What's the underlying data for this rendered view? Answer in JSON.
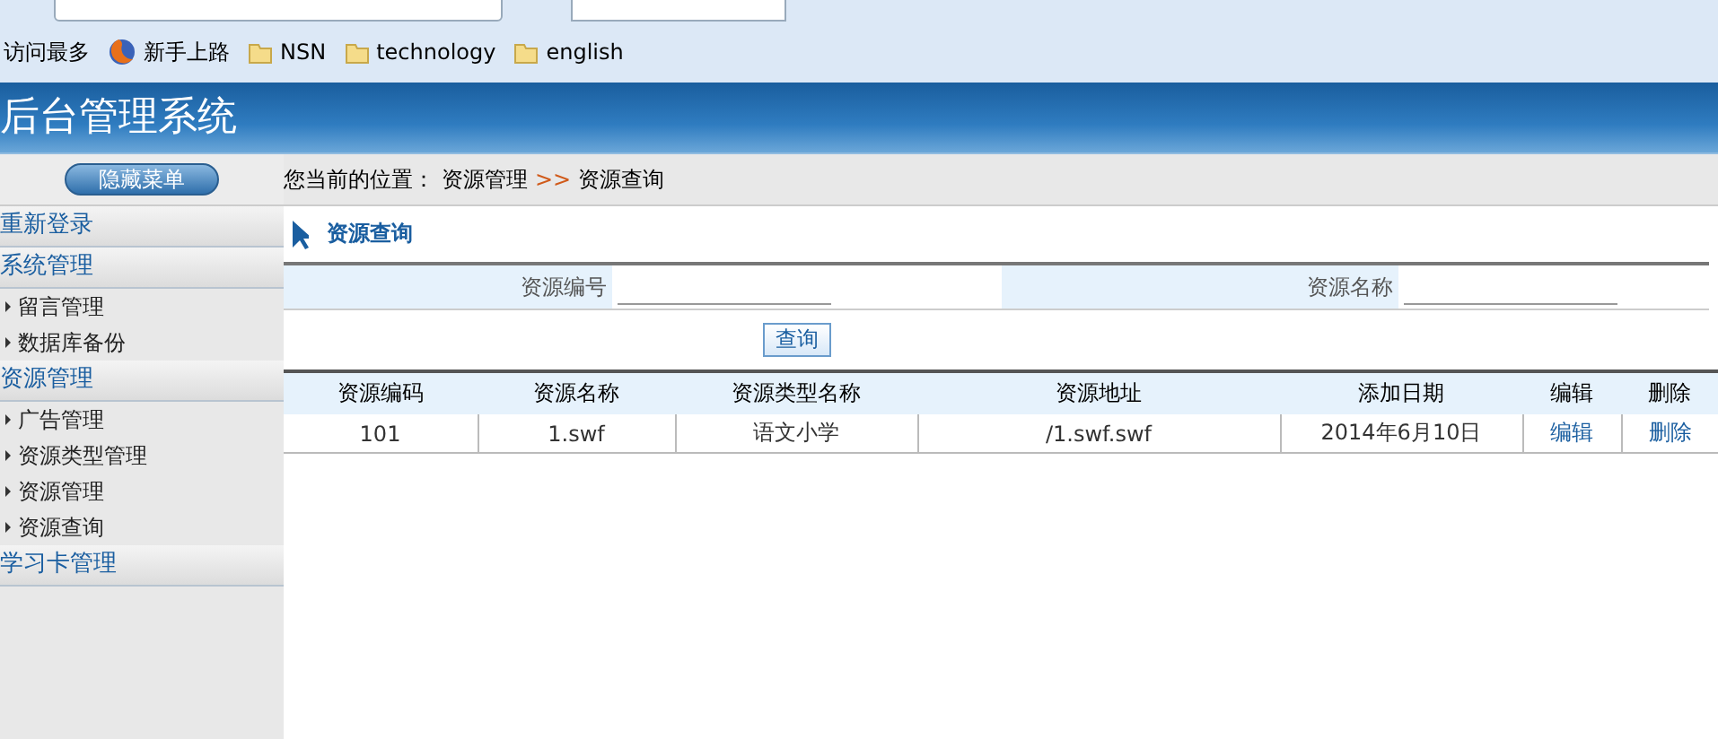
{
  "browser": {
    "bookmarks": [
      {
        "label": "访问最多",
        "kind": "plain"
      },
      {
        "label": "新手上路",
        "kind": "firefox"
      },
      {
        "label": "NSN",
        "kind": "folder"
      },
      {
        "label": "technology",
        "kind": "folder"
      },
      {
        "label": "english",
        "kind": "folder"
      }
    ]
  },
  "header": {
    "title": "后台管理系统"
  },
  "sidebar": {
    "toggle_button": "隐藏菜单",
    "groups": [
      {
        "label": "重新登录"
      },
      {
        "label": "系统管理",
        "children": [
          {
            "label": "留言管理"
          },
          {
            "label": "数据库备份"
          }
        ]
      },
      {
        "label": "资源管理",
        "children": [
          {
            "label": "广告管理"
          },
          {
            "label": "资源类型管理"
          },
          {
            "label": "资源管理"
          },
          {
            "label": "资源查询"
          }
        ]
      },
      {
        "label": "学习卡管理"
      }
    ]
  },
  "breadcrumb": {
    "prefix": "您当前的位置：",
    "path": [
      "资源管理",
      "资源查询"
    ],
    "separator": ">>"
  },
  "page_title": "资源查询",
  "form": {
    "fields": [
      {
        "label": "资源编号"
      },
      {
        "label": "资源名称"
      }
    ],
    "submit": "查询"
  },
  "table": {
    "columns": [
      "资源编码",
      "资源名称",
      "资源类型名称",
      "资源地址",
      "添加日期",
      "编辑",
      "删除"
    ],
    "rows": [
      {
        "cells": [
          "101",
          "1.swf",
          "语文小学",
          "/1.swf.swf",
          "2014年6月10日"
        ],
        "actions": [
          "编辑",
          "删除"
        ]
      }
    ]
  }
}
